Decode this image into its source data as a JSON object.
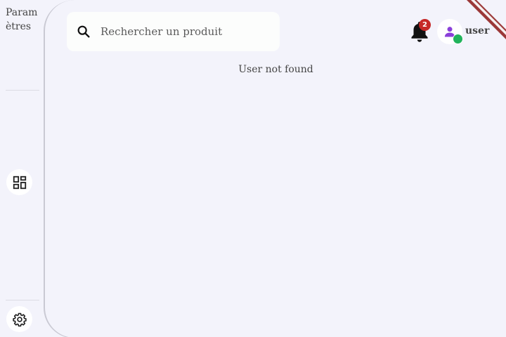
{
  "sidebar": {
    "title": "Paramètres",
    "items": [
      {
        "name": "dashboard",
        "icon": "dashboard-grid-icon"
      },
      {
        "name": "settings",
        "icon": "gear-icon"
      }
    ]
  },
  "search": {
    "placeholder": "Rechercher un produit",
    "icon": "search-icon"
  },
  "main": {
    "message": "User not found"
  },
  "header": {
    "notifications": {
      "icon": "bell-icon",
      "count": "2"
    },
    "user": {
      "icon": "user-icon",
      "name": "user",
      "status_color": "#21b35b"
    }
  },
  "colors": {
    "background": "#f3f3fb",
    "badge": "#c62828",
    "status_online": "#21b35b",
    "avatar_icon": "#8a3fd9",
    "ribbon": "#9b3838"
  }
}
